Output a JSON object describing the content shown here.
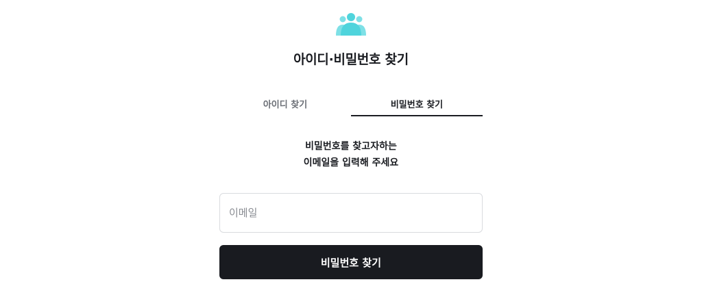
{
  "logo": {
    "icon": "users-group-icon",
    "color": "#4fd4dc"
  },
  "title": "아이디·비밀번호 찾기",
  "tabs": [
    {
      "label": "아이디 찾기",
      "active": false
    },
    {
      "label": "비밀번호 찾기",
      "active": true
    }
  ],
  "description": {
    "line1": "비밀번호를 찾고자하는",
    "line2": "이메일을 입력해 주세요"
  },
  "email_input": {
    "placeholder": "이메일",
    "value": ""
  },
  "submit_button": {
    "label": "비밀번호 찾기"
  },
  "colors": {
    "accent": "#4fd4dc",
    "button_bg": "#191b20",
    "text": "#1a1c21"
  }
}
